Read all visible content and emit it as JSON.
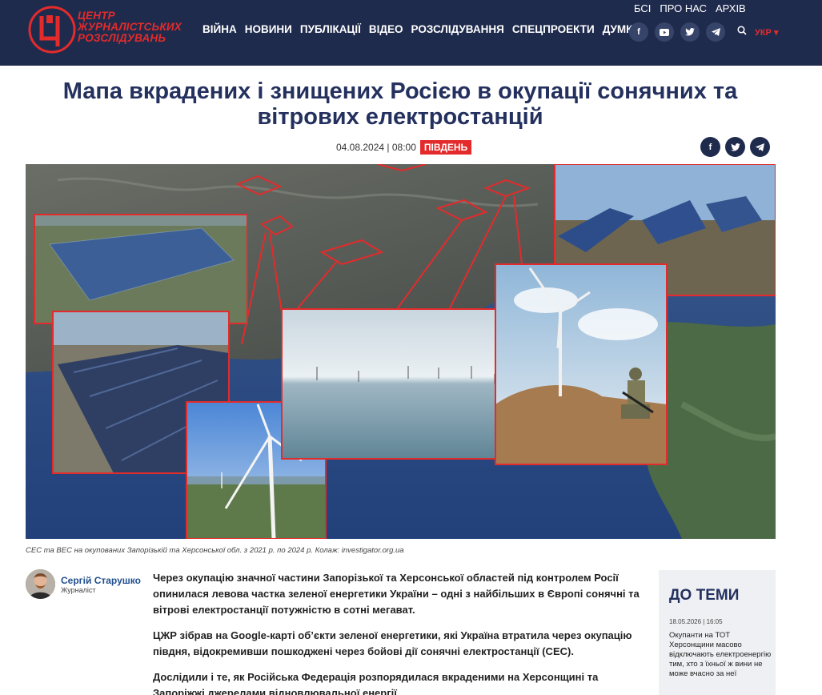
{
  "header": {
    "logo_line1": "ЦЕНТР",
    "logo_line2": "ЖУРНАЛІСТСЬКИХ",
    "logo_line3": "РОЗСЛІДУВАНЬ",
    "logo_mark": "Ц",
    "nav": [
      "ВІЙНА",
      "НОВИНИ",
      "ПУБЛІКАЦІЇ",
      "ВІДЕО",
      "РОЗСЛІДУВАННЯ",
      "СПЕЦПРОЕКТИ",
      "ДУМКИ"
    ],
    "topnav": [
      "БСІ",
      "ПРО НАС",
      "АРХІВ"
    ],
    "lang": "УКР ▾",
    "brand_color": "#e32b2b",
    "header_bg": "#1f2b4d"
  },
  "article": {
    "title_line1": "Мапа вкрадених і знищених Росією в окупації сонячних та",
    "title_line2": "вітрових електростанцій",
    "date": "04.08.2024 | 08:00",
    "region": "ПІВДЕНЬ",
    "caption": "СЕС та ВЕС на окупованих Запорізькій та Херсонської обл. з 2021 р. по 2024 р. Колаж: investigator.org.ua",
    "author_name": "Сергій Старушко",
    "author_role": "Журналіст",
    "p1": "Через окупацію значної частини Запорізької та Херсонської областей під контролем Росії опинилася левова частка зеленої енергетики України  – одні з найбільших в Європі сонячні та вітрові електростанції потужністю в сотні мегават.",
    "p2": "ЦЖР зібрав на Google-карті  об’єкти зеленої енергетики, які Україна втратила через окупацію півдня, відокремивши пошкоджені через бойові дії сонячні електростанції (СЕС).",
    "p3": "Дослідили і те, як Російська Федерація розпорядилася вкраденими на Херсонщині та Запоріжжі джерелами відновлювальної енергії"
  },
  "sidebar": {
    "title": "ДО ТЕМИ",
    "date": "18.05.2026 | 16:05",
    "text": "Окупанти на ТОТ Херсонщини масово відключають електроенергію тим, хто з їхньої ж вини не може вчасно за неї"
  },
  "icons": {
    "social_top": [
      "facebook-icon",
      "youtube-icon",
      "twitter-icon",
      "telegram-icon"
    ],
    "share": [
      "facebook-icon",
      "twitter-icon",
      "telegram-icon"
    ]
  }
}
